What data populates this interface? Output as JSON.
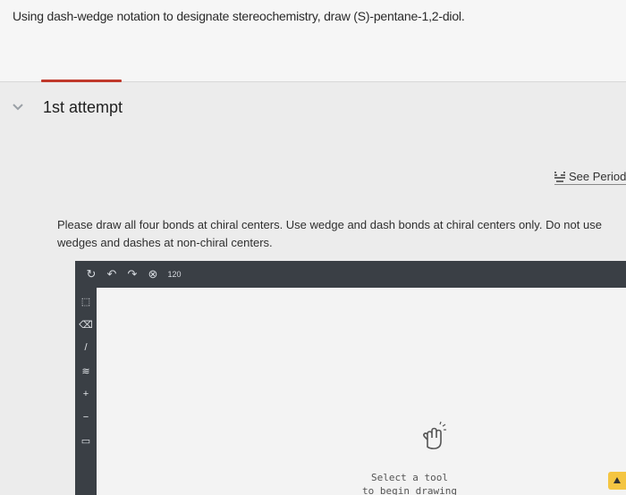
{
  "question": {
    "text": "Using dash-wedge notation to designate stereochemistry, draw (S)-pentane-1,2-diol."
  },
  "attempt": {
    "title": "1st attempt",
    "toggle_icon": "chevron-down-icon"
  },
  "periodic_link": {
    "label": "See Periodic",
    "icon": "periodic-table-icon"
  },
  "instructions": {
    "text": "Please draw all four bonds at chiral centers. Use wedge and dash bonds at chiral centers only. Do not use wedges and dashes at non-chiral centers."
  },
  "editor": {
    "toolbar": [
      {
        "name": "reset-icon",
        "glyph": "↻"
      },
      {
        "name": "undo-icon",
        "glyph": "↶"
      },
      {
        "name": "redo-icon",
        "glyph": "↷"
      },
      {
        "name": "zoom-icon",
        "glyph": "⊗"
      },
      {
        "name": "bond-angle-icon",
        "glyph": "120"
      }
    ],
    "sidebar": [
      {
        "name": "selection-tool-icon",
        "glyph": "⬚"
      },
      {
        "name": "eraser-tool-icon",
        "glyph": "⌫"
      },
      {
        "name": "single-bond-tool-icon",
        "glyph": "/"
      },
      {
        "name": "wavy-bond-tool-icon",
        "glyph": "≋"
      },
      {
        "name": "charge-plus-tool-icon",
        "glyph": "+"
      },
      {
        "name": "charge-minus-tool-icon",
        "glyph": "−"
      },
      {
        "name": "bracket-tool-icon",
        "glyph": "▭"
      }
    ],
    "hint_lines": [
      "Select a tool",
      "to begin drawing"
    ]
  },
  "colors": {
    "accent": "#c0392b",
    "toolbar_bg": "#3a3f45",
    "canvas_bg": "#f3f3f3"
  }
}
